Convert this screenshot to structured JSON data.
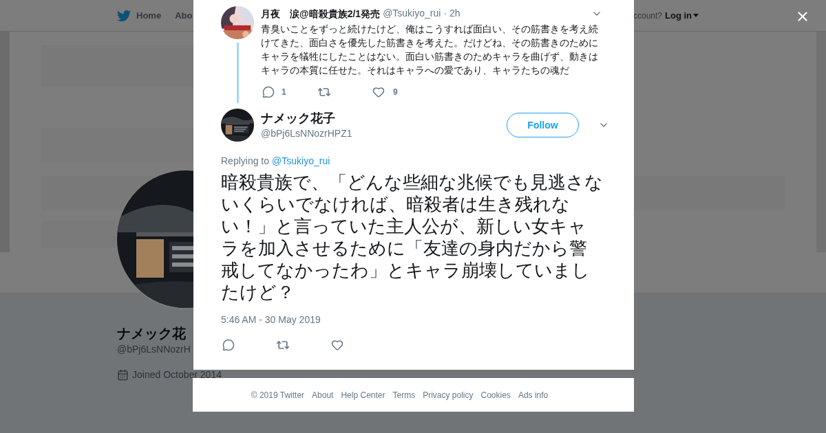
{
  "background_page": {
    "nav": {
      "home": "Home",
      "about": "Abo",
      "account_prompt": "ccount?",
      "login": "Log in"
    },
    "profile": {
      "name": "ナメック花",
      "handle": "@bPj6LsNNozrH",
      "joined": "Joined October 2014"
    }
  },
  "modal": {
    "parent_tweet": {
      "author": "月夜　涙@暗殺貴族2/1発売",
      "handle": "@Tsukiyo_rui",
      "separator": "·",
      "time": "2h",
      "text": "青臭いことをずっと続けたけど、俺はこうすれば面白い、その筋書きを考え続けてきた、面白さを優先した筋書きを考えた。だけどね、その筋書きのためにキャラを犠牲にしたことはない。面白い筋書きのためキャラを曲げず、動きはキャラの本質に任せた。それはキャラへの愛であり、キャラたちの魂だ",
      "reply_count": "1",
      "like_count": "9"
    },
    "tweet": {
      "name": "ナメック花子",
      "handle": "@bPj6LsNNozrHPZ1",
      "follow": "Follow",
      "replying_label": "Replying to",
      "replying_to": "@Tsukiyo_rui",
      "text": "暗殺貴族で、「どんな些細な兆候でも見逃さないくらいでなければ、暗殺者は生き残れない！」と言っていた主人公が、新しい女キャラを加入させるために「友達の身内だから警戒してなかったわ」とキャラ崩壊していましたけど？",
      "timestamp": "5:46 AM - 30 May 2019"
    }
  },
  "footer": {
    "links": [
      "© 2019 Twitter",
      "About",
      "Help Center",
      "Terms",
      "Privacy policy",
      "Cookies",
      "Ads info"
    ]
  }
}
